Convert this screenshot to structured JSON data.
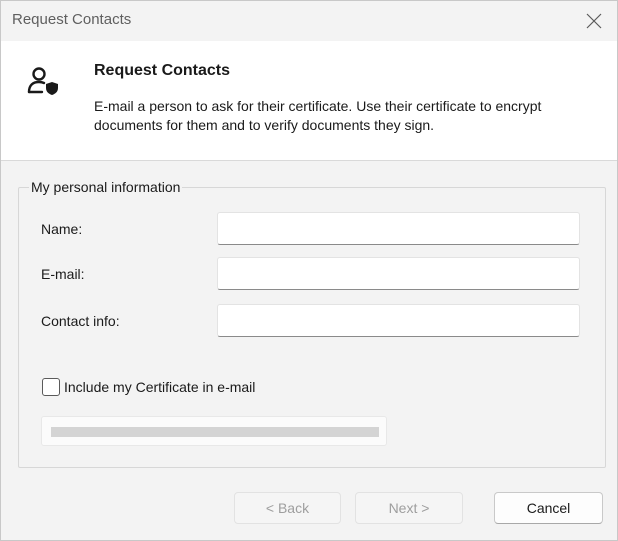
{
  "window": {
    "title": "Request Contacts"
  },
  "header": {
    "title": "Request Contacts",
    "description": "E-mail a person to ask for their certificate. Use their certificate to encrypt documents for them and to verify documents they sign.",
    "icon": "person-shield-icon"
  },
  "form": {
    "group_label": "My personal information",
    "name_label": "Name:",
    "name_value": "",
    "email_label": "E-mail:",
    "email_value": "",
    "contact_label": "Contact info:",
    "contact_value": "",
    "include_cert_label": "Include my Certificate in e-mail",
    "include_cert_checked": false
  },
  "buttons": {
    "back": "< Back",
    "next": "Next >",
    "cancel": "Cancel"
  },
  "colors": {
    "window_bg": "#f3f3f3",
    "header_bg": "#ffffff",
    "disabled_text": "#9e9e9e"
  }
}
